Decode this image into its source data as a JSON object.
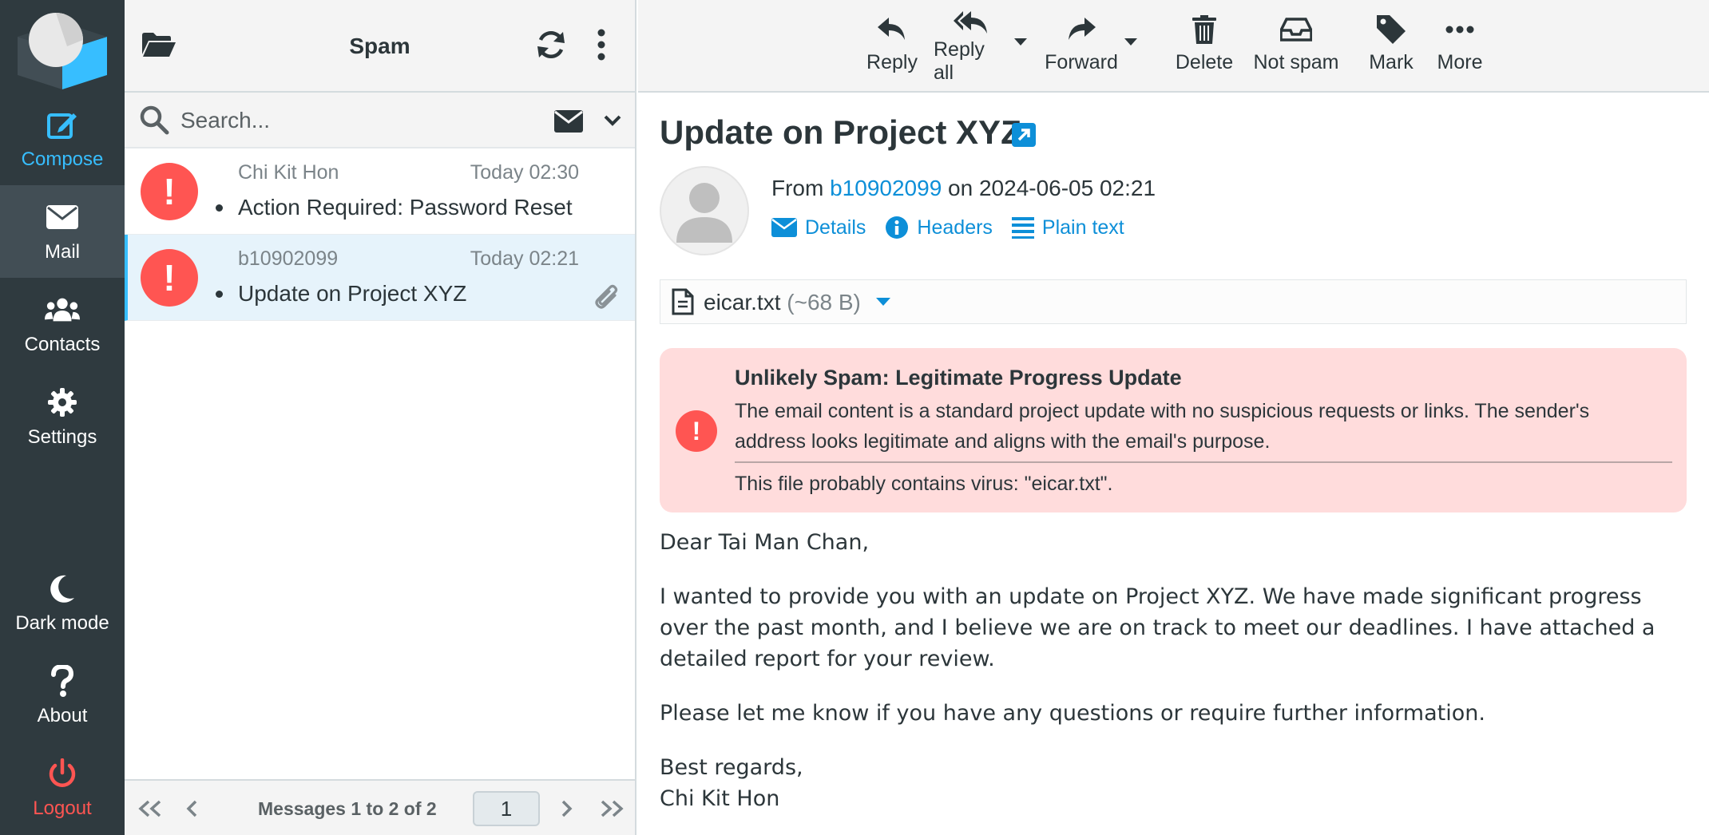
{
  "nav": {
    "items": [
      {
        "label": "Compose",
        "icon": "compose-icon"
      },
      {
        "label": "Mail",
        "icon": "mail-icon"
      },
      {
        "label": "Contacts",
        "icon": "contacts-icon"
      },
      {
        "label": "Settings",
        "icon": "gear-icon"
      },
      {
        "label": "Dark mode",
        "icon": "moon-icon"
      },
      {
        "label": "About",
        "icon": "question-icon"
      },
      {
        "label": "Logout",
        "icon": "power-icon"
      }
    ],
    "accent": "#37beff",
    "logout_color": "#ff5552"
  },
  "list": {
    "folder_title": "Spam",
    "search_placeholder": "Search...",
    "messages": [
      {
        "from": "Chi Kit Hon",
        "date": "Today 02:30",
        "subject": "Action Required: Password Reset",
        "selected": false,
        "has_attachment": false
      },
      {
        "from": "b10902099",
        "date": "Today 02:21",
        "subject": "Update on Project XYZ",
        "selected": true,
        "has_attachment": true
      }
    ],
    "footer": {
      "count_text": "Messages 1 to 2 of 2",
      "page": "1"
    }
  },
  "toolbar": {
    "reply": "Reply",
    "reply_all": "Reply all",
    "forward": "Forward",
    "delete": "Delete",
    "not_spam": "Not spam",
    "mark": "Mark",
    "more": "More"
  },
  "message": {
    "subject": "Update on Project XYZ",
    "from_prefix": "From",
    "sender": "b10902099",
    "on_text": "on 2024-06-05 02:21",
    "links": {
      "details": "Details",
      "headers": "Headers",
      "plain_text": "Plain text"
    },
    "attachment": {
      "name": "eicar.txt",
      "size": "(~68 B)"
    },
    "alert": {
      "title": "Unlikely Spam: Legitimate Progress Update",
      "text": "The email content is a standard project update with no suspicious requests or links. The sender's address looks legitimate and aligns with the email's purpose.",
      "virus_note": "This file probably contains virus: \"eicar.txt\"."
    },
    "body": {
      "greeting": "Dear Tai Man Chan,",
      "p1": "I wanted to provide you with an update on Project XYZ. We have made significant progress over the past month, and I believe we are on track to meet our deadlines. I have attached a detailed report for your review.",
      "p2": "Please let me know if you have any questions or require further information.",
      "closing": "Best regards,",
      "signature": "Chi Kit Hon"
    }
  }
}
